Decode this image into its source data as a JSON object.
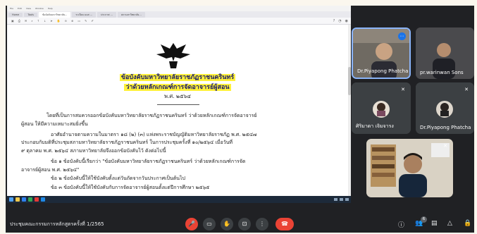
{
  "shared_screen": {
    "menu": [
      "File",
      "Edit",
      "View",
      "Window",
      "Help"
    ],
    "tabs": [
      "Home",
      "Tools",
      "ข้อบังคับมหาวิทยาลัย...",
      "ระเบียบ มมส ...",
      "ประกาศ ...",
      "สภามหาวิทยาลัย..."
    ],
    "document": {
      "title_line1": "ข้อบังคับมหาวิทยาลัยราชภัฏราชนครินทร์",
      "title_line2": "ว่าด้วยหลักเกณฑ์การจัดอาจารย์ผู้สอน",
      "title_line3": "พ.ศ. ๒๕๖๔",
      "body": [
        "โดยที่เป็นการสมควรออกข้อบังคับมหาวิทยาลัยราชภัฏราชนครินทร์ ว่าด้วยหลักเกณฑ์การจัดอาจารย์",
        "ผู้สอน ให้มีความเหมาะสมยิ่งขึ้น",
        "อาศัยอำนาจตามความในมาตรา ๑๘ (๒) (๓) แห่งพระราชบัญญัติมหาวิทยาลัยราชภัฏ พ.ศ. ๒๕๔๗",
        "ประกอบกับมติที่ประชุมสภามหาวิทยาลัยราชภัฏราชนครินทร์ ในการประชุมครั้งที่ ๑๐/๒๕๖๔ เมื่อวันที่",
        "๙ ตุลาคม พ.ศ. ๒๕๖๔ สภามหาวิทยาลัยจึงออกข้อบังคับไว้ ดังต่อไปนี้",
        "ข้อ ๑  ข้อบังคับนี้เรียกว่า \"ข้อบังคับมหาวิทยาลัยราชภัฏราชนครินทร์ ว่าด้วยหลักเกณฑ์การจัด",
        "อาจารย์ผู้สอน พ.ศ. ๒๕๖๔\"",
        "ข้อ ๒  ข้อบังคับนี้ให้ใช้บังคับตั้งแต่วันถัดจากวันประกาศเป็นต้นไป",
        "ข้อ ๓  ข้อบังคับนี้ให้ใช้บังคับกับการจัดอาจารย์ผู้สอนตั้งแต่ปีการศึกษา ๒๕๖๕"
      ]
    }
  },
  "participants": [
    {
      "name": "Dr.Piyapong Phatcha",
      "mic_off": false,
      "has_more_button": true
    },
    {
      "name": "pr.warinwan Sons",
      "mic_off": false
    },
    {
      "name": "ศิริมาดา เจิมจารง",
      "mic_off": true
    },
    {
      "name": "Dr.Piyapong Phatcha",
      "mic_off": true
    },
    {
      "name": "",
      "mic_off": true,
      "self_view": true
    }
  ],
  "meeting": {
    "title": "ประชุมคณะกรรมการหลักสูตรครั้งที่ 1/2565",
    "people_count": "6"
  },
  "icons": {
    "more": "⋯",
    "mic_off": "✕",
    "mic_button": "🎤",
    "camera": "▭",
    "raise_hand": "✋",
    "present": "⊡",
    "more_options": "⋮",
    "end_call": "☎",
    "info": "ⓘ",
    "people": "👥",
    "chat": "▤",
    "activities": "△",
    "lock": "🔒"
  },
  "colors": {
    "highlight": "#fff13a",
    "end_call": "#ea4335",
    "active_border": "#8ab4f8"
  }
}
